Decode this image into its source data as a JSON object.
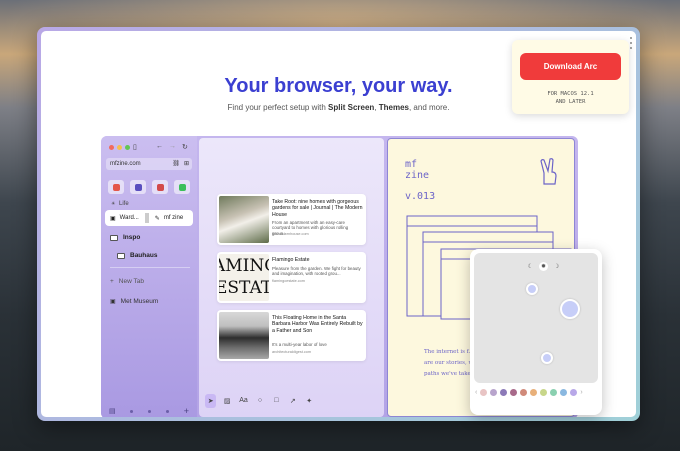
{
  "hero": {
    "title": "Your browser, your way.",
    "subtitle_pre": "Find your perfect setup with ",
    "subtitle_split": "Split Screen",
    "subtitle_mid": ", ",
    "subtitle_themes": "Themes",
    "subtitle_post": ", and more."
  },
  "download": {
    "button_label": "Download Arc",
    "platform_line1": "FOR MACOS 12.1",
    "platform_line2": "AND LATER"
  },
  "browser": {
    "url": "mfzine.com",
    "section_label": "Life",
    "split_tab_left": "Ward...",
    "split_tab_right": "mf zine",
    "folder_inspo": "Inspo",
    "folder_bauhaus": "Bauhaus",
    "new_tab": "New Tab",
    "tab_met": "Met Museum"
  },
  "cards": [
    {
      "title": "Take Root: nine homes with gorgeous gardens for sale | Journal | The Modern House",
      "desc": "From an apartment with an easy-care courtyard to homes with glorious rolling groun...",
      "url": "themodernhouse.com"
    },
    {
      "title": "Flamingo Estate",
      "desc": "Pleasure from the garden. We fight for beauty and imagination, with rooted grou...",
      "url": "flamingoestate.com"
    },
    {
      "title": "This Floating Home in the Santa Barbara Harbor Was Entirely Rebuilt by a Father and Son",
      "desc": "It's a multi-year labor of love",
      "url": "architecturaldigest.com"
    }
  ],
  "estate_thumb_text": [
    "AMING",
    "ESTAT"
  ],
  "zine": {
    "name_line1": "mf",
    "name_line2": "zine",
    "version": "v.013",
    "body_line1": "The internet is f...",
    "body_line2": "are our stories, w...",
    "body_line3": "paths we've take..."
  },
  "toolbar": {
    "text_tool": "Aa"
  },
  "colors": {
    "accent": "#3b3fd1",
    "download_red": "#f03b3b",
    "zine_purple": "#6c64c8",
    "zine_bg": "#fdf8de"
  },
  "swatch_colors": [
    "#e8c4c4",
    "#b8a4cc",
    "#8c7ab8",
    "#a86a8a",
    "#d08a7a",
    "#e8b07a",
    "#c8d68a",
    "#8ad0b0",
    "#8ab8e0",
    "#b8a8e8"
  ]
}
